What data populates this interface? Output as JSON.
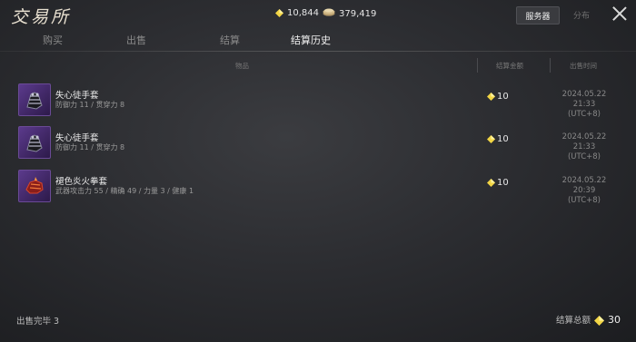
{
  "header": {
    "title": "交易所",
    "currency1": "10,844",
    "currency2": "379,419",
    "toggle_server": "服务器",
    "toggle_local": "分布"
  },
  "tabs": [
    "购买",
    "出售",
    "结算",
    "结算历史"
  ],
  "active_tab": 3,
  "columns": {
    "item": "物品",
    "amount": "结算金额",
    "time": "出售时间"
  },
  "rows": [
    {
      "name": "失心徒手套",
      "stats": "防御力 11 / 贯穿力 8",
      "price": "10",
      "time_line1": "2024.05.22 21:33",
      "time_line2": "(UTC+8)",
      "icon": "gauntlet-icon"
    },
    {
      "name": "失心徒手套",
      "stats": "防御力 11 / 贯穿力 8",
      "price": "10",
      "time_line1": "2024.05.22 21:33",
      "time_line2": "(UTC+8)",
      "icon": "gauntlet-icon"
    },
    {
      "name": "褪色炎火拳套",
      "stats": "武器攻击力 55 / 精确 49 / 力量 3 / 健康 1",
      "price": "10",
      "time_line1": "2024.05.22 20:39",
      "time_line2": "(UTC+8)",
      "icon": "fire-fist-icon"
    }
  ],
  "footer": {
    "sold_label": "出售完毕",
    "sold_count": "3",
    "total_label": "结算总额",
    "total_value": "30"
  },
  "colors": {
    "gem": "#f2d545",
    "accent_purple": "#5b3a8c"
  }
}
